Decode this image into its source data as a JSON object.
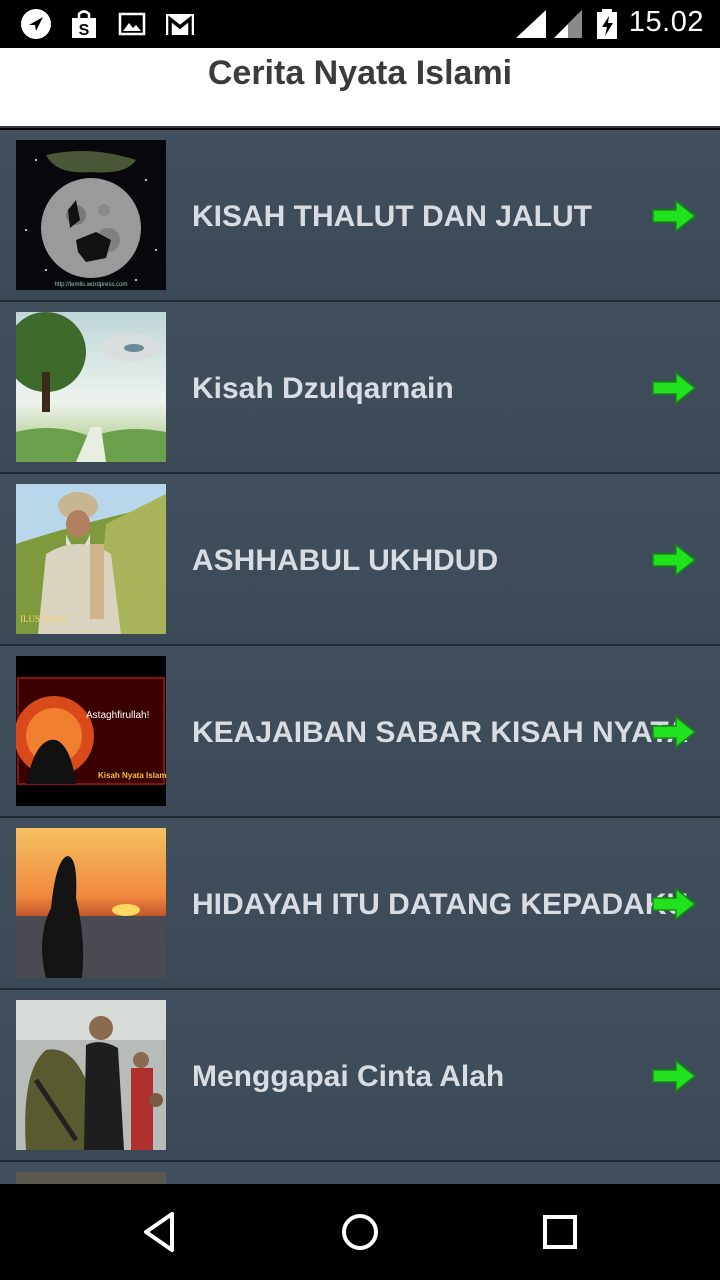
{
  "status_bar": {
    "time": "15.02",
    "icons": [
      "navigation-icon",
      "shop-bag-icon",
      "image-icon",
      "gmail-icon",
      "signal-icon",
      "signal-icon",
      "battery-charging-icon"
    ]
  },
  "app": {
    "title": "Cerita Nyata Islami"
  },
  "items": [
    {
      "title": "KISAH THALUT DAN JALUT"
    },
    {
      "title": "Kisah Dzulqarnain"
    },
    {
      "title": "ASHHABUL UKHDUD"
    },
    {
      "title": "KEAJAIBAN SABAR KISAH NYATA"
    },
    {
      "title": "HIDAYAH ITU DATANG KEPADAKU"
    },
    {
      "title": "Menggapai Cinta Alah"
    }
  ],
  "thumb_text": {
    "moon_caption": "http://temlis.wordpress.com",
    "ilustrasi": "ILUSTRASI",
    "astaghfirullah": "Astaghfirullah!",
    "kisah_label": "Kisah Nyata Islami"
  },
  "nav_bar": {
    "icons": [
      "back-icon",
      "home-icon",
      "recents-icon"
    ]
  },
  "colors": {
    "list_bg": "#3b4856",
    "title_text": "#d9dde2",
    "arrow": "#22e11e",
    "header_text": "#3b3b3b"
  }
}
